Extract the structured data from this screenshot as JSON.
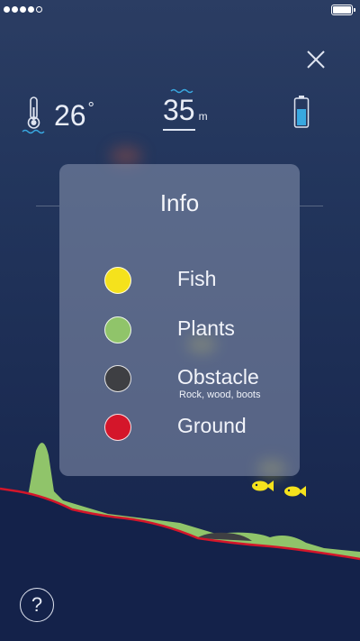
{
  "status": {
    "signal_dots": 5,
    "signal_filled": 4,
    "battery": "full"
  },
  "readouts": {
    "temperature": {
      "value": "26",
      "unit": "°",
      "icon": "thermometer-water-icon"
    },
    "depth": {
      "value": "35",
      "unit": "m",
      "icon": "water-depth-icon"
    },
    "device_battery": {
      "icon": "battery-icon",
      "level": 0.6,
      "color": "#39a8e0"
    }
  },
  "info_panel": {
    "title": "Info",
    "items": [
      {
        "label": "Fish",
        "color": "#f5e21c"
      },
      {
        "label": "Plants",
        "color": "#90c46a"
      },
      {
        "label": "Obstacle",
        "sublabel": "Rock, wood, boots",
        "color": "#3e3f43"
      },
      {
        "label": "Ground",
        "color": "#d4162a"
      }
    ]
  },
  "help": {
    "label": "?"
  },
  "colors": {
    "background": "#1d2e55",
    "ground_line": "#d4162a",
    "plants": "#90c46a",
    "fish": "#f5e21c",
    "obstacle": "#3e3f43"
  }
}
